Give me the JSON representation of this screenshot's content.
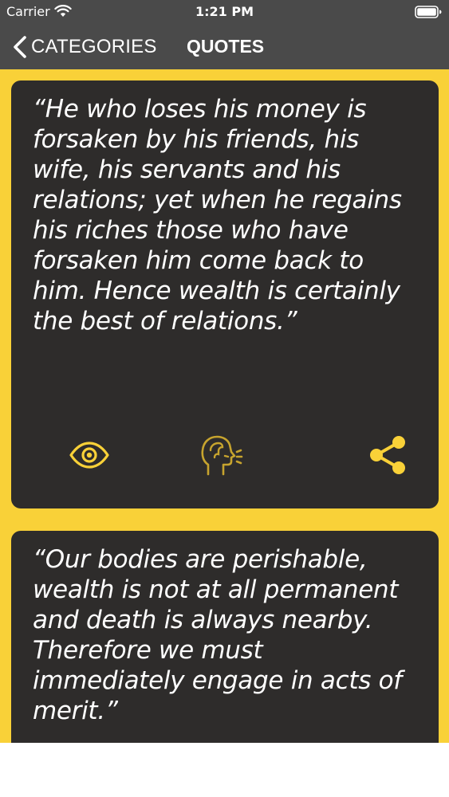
{
  "status_bar": {
    "carrier": "Carrier",
    "time": "1:21 PM"
  },
  "nav": {
    "back_label": "CATEGORIES",
    "title": "QUOTES"
  },
  "quotes": [
    {
      "text": "“He who loses his money is forsaken by his friends, his wife, his servants and his relations; yet when he regains his riches those who have forsaken him come back to him. Hence wealth is certainly the best of relations.”",
      "actions": {
        "view_icon": "eye-icon",
        "speak_icon": "speaking-head-icon",
        "share_icon": "share-icon"
      }
    },
    {
      "text": "“Our bodies are perishable, wealth is not at all permanent and death is always nearby. Therefore we must immediately engage in acts of merit.”"
    }
  ],
  "colors": {
    "accent": "#f9d138",
    "card": "#2e2c2b",
    "nav_bar": "#4a4a4a",
    "text": "#ffffff"
  }
}
